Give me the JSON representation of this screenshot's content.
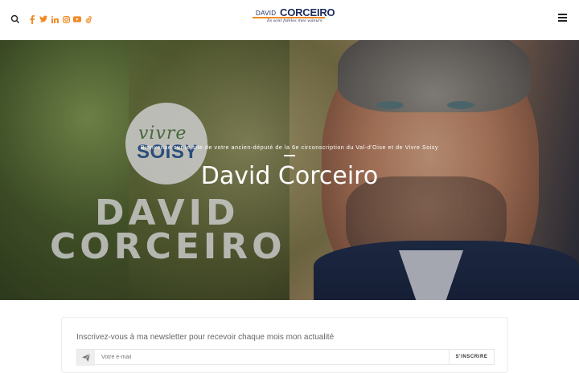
{
  "header": {
    "search_icon": "search-icon",
    "socials": [
      {
        "name": "facebook-icon",
        "color": "#f08a24"
      },
      {
        "name": "twitter-icon",
        "color": "#f08a24"
      },
      {
        "name": "linkedin-icon",
        "color": "#f08a24"
      },
      {
        "name": "instagram-icon",
        "color": "#f08a24"
      },
      {
        "name": "youtube-icon",
        "color": "#f08a24"
      },
      {
        "name": "tiktok-icon",
        "color": "#f08a24"
      }
    ],
    "logo": {
      "prefix": "DAVID",
      "name": "CORCEIRO",
      "tagline": "Ils sont fidèles mes valeurs"
    },
    "menu_icon": "hamburger-menu-icon"
  },
  "hero": {
    "overtitle": "Bienvenue sur le site de votre ancien-député de la 6e circonscription du Val-d'Oise et de Vivre Soisy",
    "title": "David Corceiro",
    "badge_line1": "vivre",
    "badge_line2": "SOISY",
    "big_name_line1": "DAVID",
    "big_name_line2": "CORCEIRO"
  },
  "newsletter": {
    "text": "Inscrivez-vous à ma newsletter pour recevoir chaque mois mon actualité",
    "email_placeholder": "Votre e-mail",
    "submit_label": "S'INSCRIRE"
  },
  "colors": {
    "accent": "#f08a24",
    "navy": "#1d2a5c"
  }
}
